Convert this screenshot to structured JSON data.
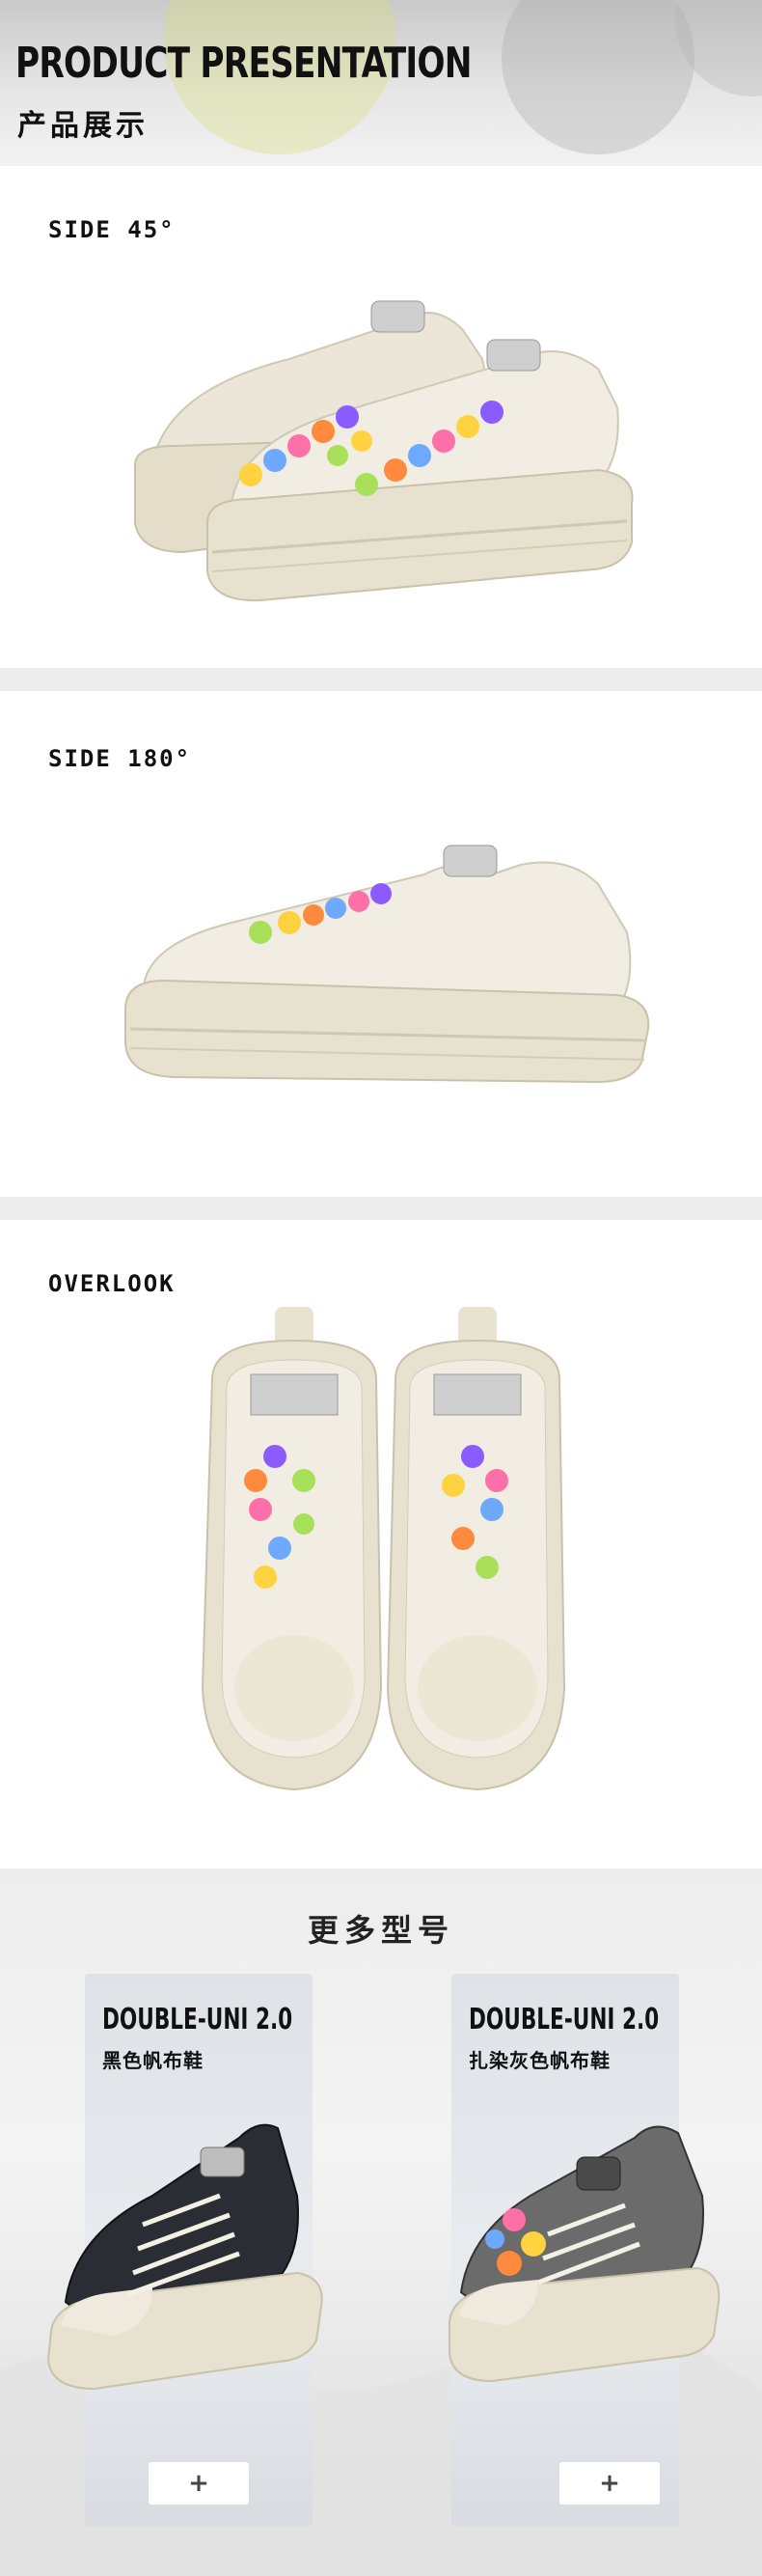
{
  "header": {
    "title": "PRODUCT PRESENTATION",
    "subtitle": "产品展示"
  },
  "sections": {
    "side45": {
      "label": "SIDE 45°"
    },
    "side180": {
      "label": "SIDE 180°"
    },
    "overlook": {
      "label": "OVERLOOK"
    }
  },
  "more": {
    "title": "更多型号",
    "cards": [
      {
        "title": "DOUBLE-UNI 2.0",
        "subtitle": "黑色帆布鞋",
        "button": "+"
      },
      {
        "title": "DOUBLE-UNI 2.0",
        "subtitle": "扎染灰色帆布鞋",
        "button": "+"
      }
    ]
  },
  "colors": {
    "shoe_cream": "#efeadd",
    "sole_cream": "#e7e1cf",
    "charm_colors": [
      "#ff8a3d",
      "#ff6fa8",
      "#6fa8ff",
      "#a8e05a",
      "#ffd23f",
      "#8a5cff"
    ],
    "black_denim": "#2a2d33",
    "grey_tiedye": "#6b6b6b"
  }
}
